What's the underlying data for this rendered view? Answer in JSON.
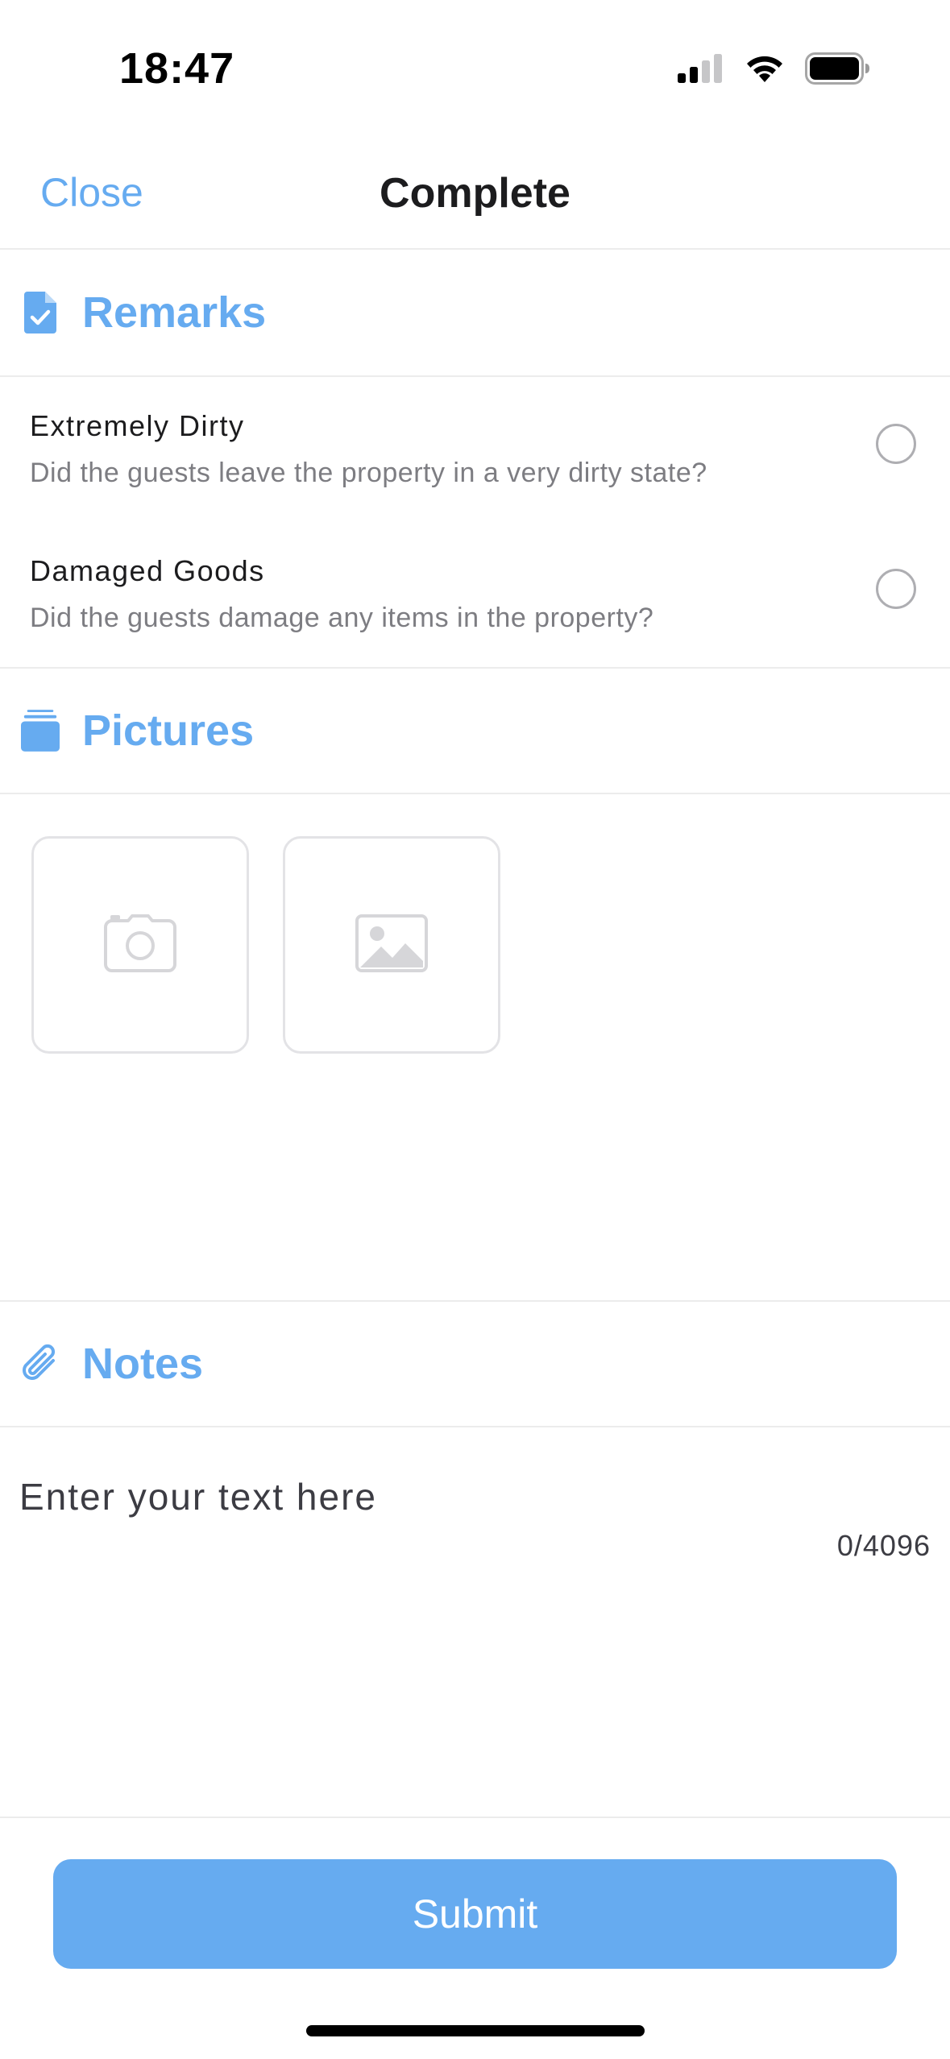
{
  "status_bar": {
    "time": "18:47",
    "icons": [
      "cellular-signal-icon",
      "wifi-icon",
      "battery-icon"
    ]
  },
  "header": {
    "close_label": "Close",
    "title": "Complete"
  },
  "sections": {
    "remarks": {
      "title": "Remarks",
      "icon": "document-check-icon",
      "items": [
        {
          "title": "Extremely Dirty",
          "description": "Did the guests leave the property in a very dirty state?",
          "selected": false
        },
        {
          "title": "Damaged Goods",
          "description": "Did the guests damage any items in the property?",
          "selected": false
        }
      ]
    },
    "pictures": {
      "title": "Pictures",
      "icon": "stack-icon",
      "tiles": [
        {
          "icon": "camera-icon"
        },
        {
          "icon": "image-icon"
        }
      ]
    },
    "notes": {
      "title": "Notes",
      "icon": "paperclip-icon",
      "placeholder": "Enter your text here",
      "value": "",
      "counter": "0/4096"
    }
  },
  "footer": {
    "submit_label": "Submit"
  },
  "colors": {
    "accent": "#66abf0",
    "title_text": "#1c1c1e",
    "secondary_text": "#7d7d82",
    "divider": "#ececec"
  }
}
